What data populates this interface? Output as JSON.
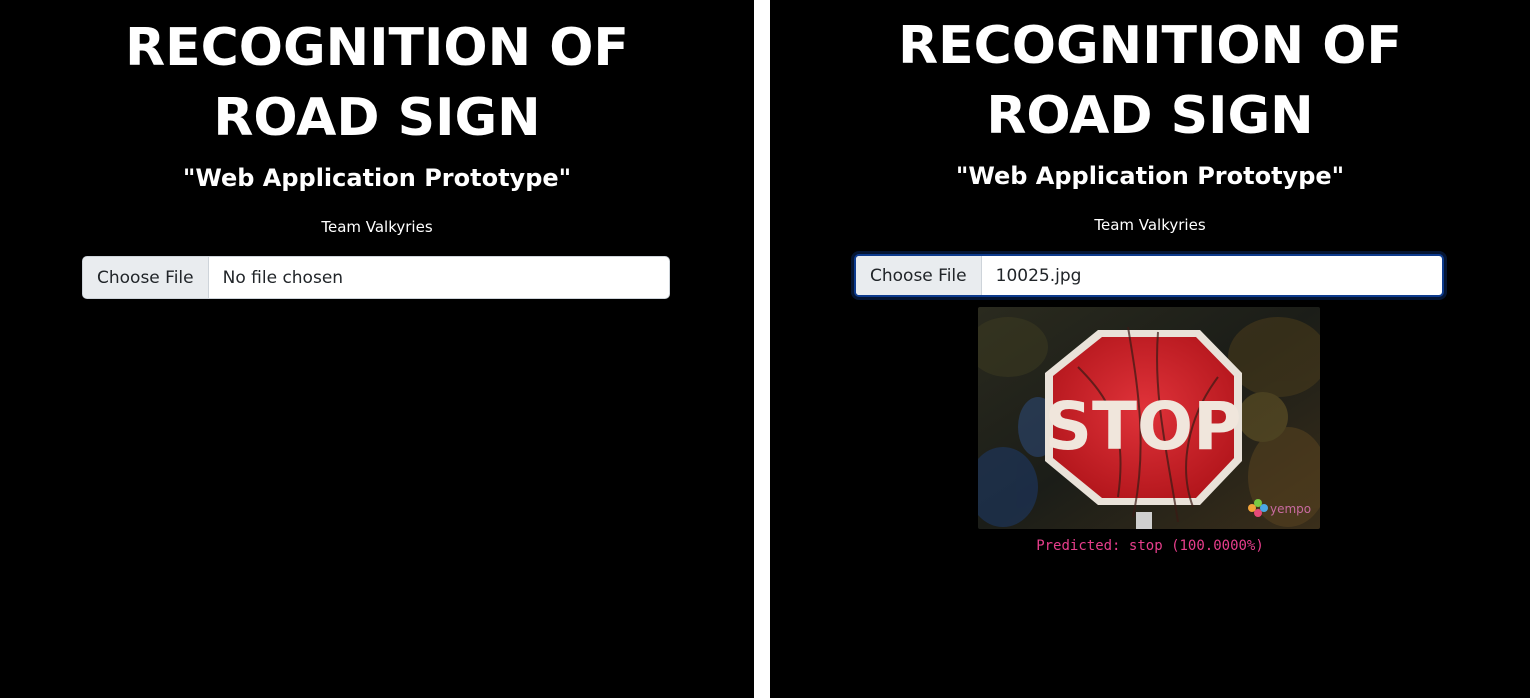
{
  "screens": [
    {
      "title_line1": "RECOGNITION OF",
      "title_line2": "ROAD SIGN",
      "subtitle": "\"Web Application Prototype\"",
      "team": "Team Valkyries",
      "file_input": {
        "button_label": "Choose File",
        "file_name": "No file chosen"
      }
    },
    {
      "title_line1": "RECOGNITION OF",
      "title_line2": "ROAD SIGN",
      "subtitle": "\"Web Application Prototype\"",
      "team": "Team Valkyries",
      "file_input": {
        "button_label": "Choose File",
        "file_name": "10025.jpg"
      },
      "preview": {
        "sign_text": "STOP",
        "watermark": "yempo"
      },
      "prediction": "Predicted: stop (100.0000%)"
    }
  ],
  "colors": {
    "background": "#000000",
    "text": "#ffffff",
    "prediction": "#e83e8c",
    "focus_ring": "#0d3b8e",
    "sign_red": "#d8262c"
  }
}
